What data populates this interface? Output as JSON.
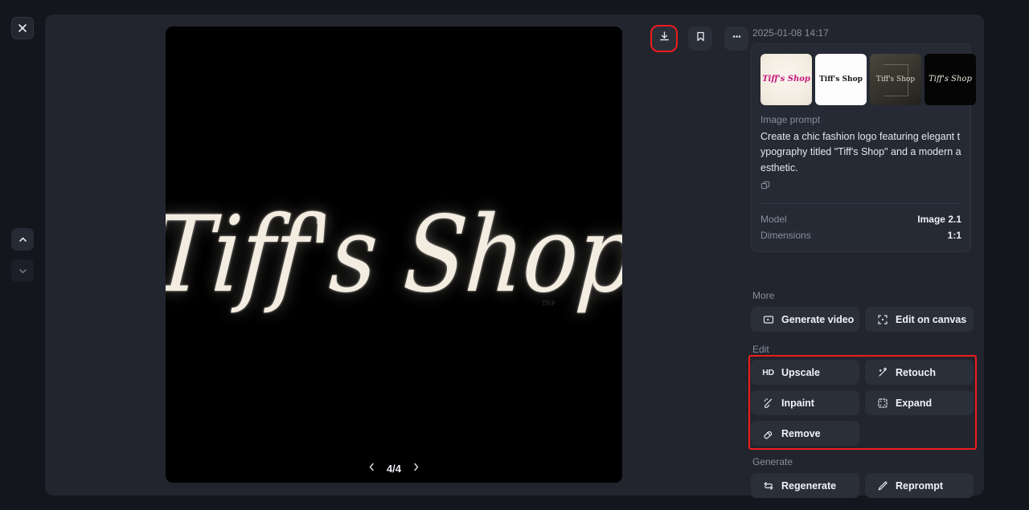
{
  "rail": {
    "close_icon": "close-icon",
    "prev_icon": "chevron-up-icon",
    "next_icon": "chevron-down-icon"
  },
  "toolbar": {
    "download_label": "Download",
    "bookmark_label": "Bookmark",
    "more_label": "More options"
  },
  "viewer": {
    "artwork_text": "Tiff's Shop",
    "watermark": "TNF",
    "page_indicator": "4/4",
    "prev_label": "Previous image",
    "next_label": "Next image"
  },
  "details": {
    "timestamp": "2025-01-08 14:17",
    "thumbnails": [
      {
        "caption": "Tiff's Shop",
        "style": "cream-magenta"
      },
      {
        "caption": "Tiff's Shop",
        "style": "white-serif"
      },
      {
        "caption": "Tiff's Shop",
        "style": "dark-olive-frame"
      },
      {
        "caption": "Tiff's Shop",
        "style": "black-script"
      }
    ],
    "prompt_label": "Image prompt",
    "prompt_text": "Create a chic fashion logo featuring elegant typography titled \"Tiff's Shop\" and a modern aesthetic.",
    "copy_label": "Copy prompt",
    "fields": [
      {
        "key": "Model",
        "value": "Image 2.1"
      },
      {
        "key": "Dimensions",
        "value": "1:1"
      }
    ]
  },
  "sections": {
    "more": {
      "label": "More",
      "actions": [
        {
          "label": "Generate video",
          "icon": "video-icon"
        },
        {
          "label": "Edit on canvas",
          "icon": "canvas-icon"
        }
      ]
    },
    "edit": {
      "label": "Edit",
      "highlighted": true,
      "actions": [
        {
          "label": "Upscale",
          "icon": "hd-icon"
        },
        {
          "label": "Retouch",
          "icon": "wand-icon"
        },
        {
          "label": "Inpaint",
          "icon": "brush-icon"
        },
        {
          "label": "Expand",
          "icon": "expand-icon"
        }
      ],
      "actions_last": [
        {
          "label": "Remove",
          "icon": "eraser-icon"
        }
      ]
    },
    "generate": {
      "label": "Generate",
      "actions": [
        {
          "label": "Regenerate",
          "icon": "refresh-icon"
        },
        {
          "label": "Reprompt",
          "icon": "pencil-icon"
        }
      ]
    }
  },
  "colors": {
    "page_background": "#14161d",
    "panel_background": "#22252e",
    "card_background": "#262a34",
    "button_background": "#2b2f3a",
    "highlight": "#f01c1c",
    "text_primary": "#eef0f5",
    "text_muted": "#878e9d"
  }
}
